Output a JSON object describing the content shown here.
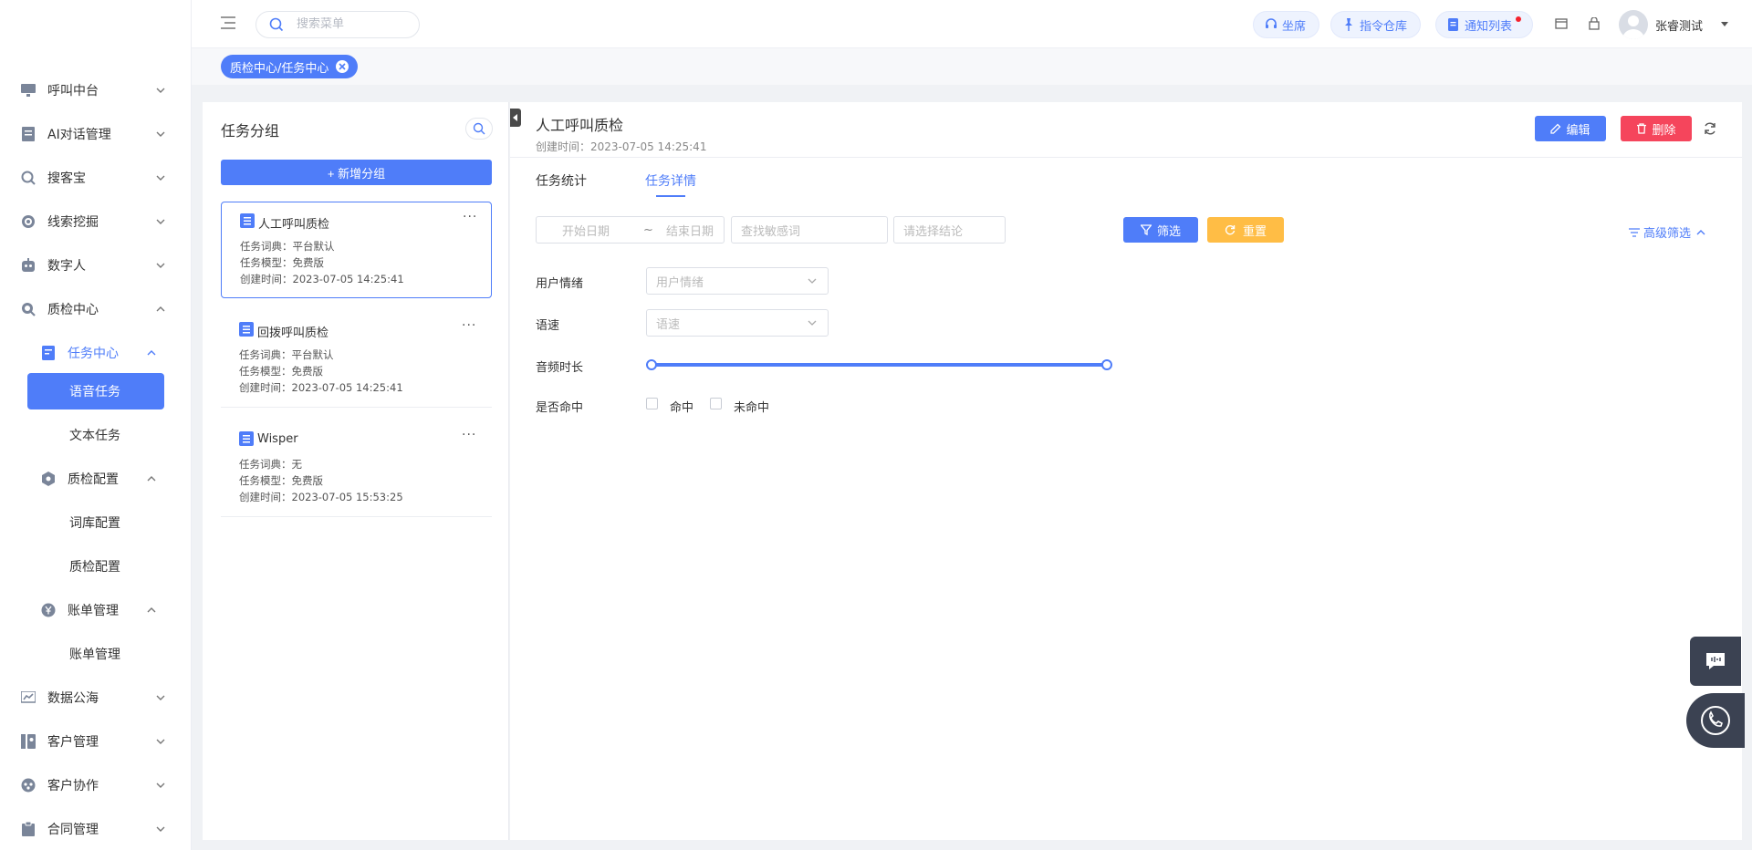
{
  "sidebar": {
    "items": [
      {
        "label": "呼叫中台",
        "icon": "monitor-icon"
      },
      {
        "label": "AI对话管理",
        "icon": "document-icon"
      },
      {
        "label": "搜客宝",
        "icon": "search-icon"
      },
      {
        "label": "线索挖掘",
        "icon": "target-icon"
      },
      {
        "label": "数字人",
        "icon": "robot-icon"
      },
      {
        "label": "质检中心",
        "icon": "inspect-icon"
      },
      {
        "label": "数据公海",
        "icon": "chart-icon"
      },
      {
        "label": "客户管理",
        "icon": "customer-icon"
      },
      {
        "label": "客户协作",
        "icon": "collab-icon"
      },
      {
        "label": "合同管理",
        "icon": "clipboard-icon"
      }
    ],
    "task_center": {
      "label": "任务中心",
      "icon": "task-icon"
    },
    "voice_task": {
      "label": "语音任务"
    },
    "text_task": {
      "label": "文本任务"
    },
    "qc_config": {
      "label": "质检配置",
      "icon": "hexagon-icon"
    },
    "dict_config": {
      "label": "词库配置"
    },
    "qc_config_leaf": {
      "label": "质检配置"
    },
    "billing": {
      "label": "账单管理",
      "icon": "yen-icon"
    },
    "billing_leaf": {
      "label": "账单管理"
    }
  },
  "header": {
    "search_placeholder": "搜索菜单",
    "seat_label": "坐席",
    "command_label": "指令仓库",
    "notice_label": "通知列表",
    "user_name": "张睿测试"
  },
  "tabbar": {
    "tag_label": "质检中心/任务中心"
  },
  "left_panel": {
    "title": "任务分组",
    "add_button": "+ 新增分组",
    "cards": [
      {
        "name": "人工呼叫质检",
        "dict": "任务词典：平台默认",
        "model": "任务模型：免费版",
        "created": "创建时间：2023-07-05 14:25:41"
      },
      {
        "name": "回拨呼叫质检",
        "dict": "任务词典：平台默认",
        "model": "任务模型：免费版",
        "created": "创建时间：2023-07-05 14:25:41"
      },
      {
        "name": "Wisper",
        "dict": "任务词典：无",
        "model": "任务模型：免费版",
        "created": "创建时间：2023-07-05 15:53:25"
      }
    ],
    "more": "···"
  },
  "right_panel": {
    "title": "人工呼叫质检",
    "created": "创建时间：2023-07-05 14:25:41",
    "edit_label": "编辑",
    "delete_label": "删除",
    "tabs": [
      "任务统计",
      "任务详情"
    ],
    "filters": {
      "start_date": "开始日期",
      "sep": "~",
      "end_date": "结束日期",
      "keyword": "查找敏感词",
      "conclusion": "请选择结论",
      "filter_btn": "筛选",
      "reset_btn": "重置",
      "advanced": "高级筛选"
    },
    "fields": {
      "emotion_label": "用户情绪",
      "emotion_placeholder": "用户情绪",
      "speed_label": "语速",
      "speed_placeholder": "语速",
      "duration_label": "音频时长",
      "hit_label": "是否命中",
      "hit_option": "命中",
      "miss_option": "未命中"
    }
  },
  "colors": {
    "accent": "#4f7df9",
    "danger": "#f5455c",
    "warning": "#ffbd45"
  }
}
